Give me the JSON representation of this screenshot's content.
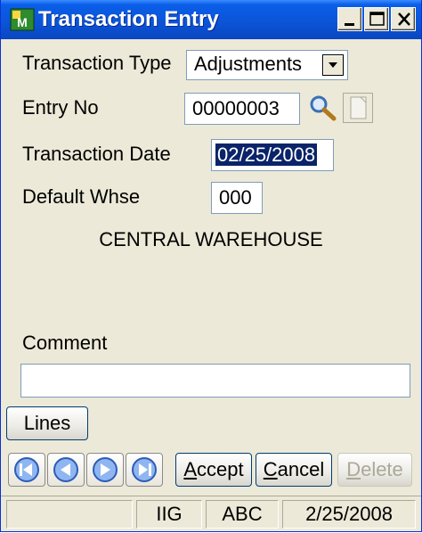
{
  "window": {
    "title": "Transaction Entry"
  },
  "form": {
    "transaction_type_label": "Transaction Type",
    "transaction_type_value": "Adjustments",
    "entry_no_label": "Entry No",
    "entry_no_value": "00000003",
    "transaction_date_label": "Transaction Date",
    "transaction_date_value": "02/25/2008",
    "default_whse_label": "Default Whse",
    "default_whse_value": "000",
    "warehouse_name": "CENTRAL WAREHOUSE",
    "comment_label": "Comment",
    "comment_value": ""
  },
  "buttons": {
    "lines": "Lines",
    "accept_u": "A",
    "accept_rest": "ccept",
    "cancel_u": "C",
    "cancel_rest": "ancel",
    "delete_u": "D",
    "delete_rest": "elete"
  },
  "statusbar": {
    "cell1": "",
    "cell2": "IIG",
    "cell3": "ABC",
    "cell4": "2/25/2008"
  },
  "icons": [
    "app-icon",
    "minimize-icon",
    "maximize-icon",
    "close-icon",
    "dropdown-arrow-icon",
    "search-icon",
    "new-entry-icon",
    "first-record-icon",
    "previous-record-icon",
    "next-record-icon",
    "last-record-icon"
  ],
  "colors": {
    "titlebar": "#0b55d8",
    "selection": "#0a246a",
    "button_border": "#003c74",
    "window_bg": "#ece9d8"
  }
}
